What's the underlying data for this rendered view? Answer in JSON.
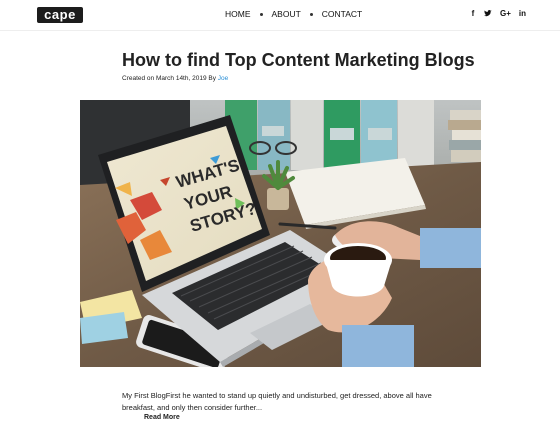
{
  "header": {
    "logo": "cape",
    "nav": [
      {
        "label": "HOME"
      },
      {
        "label": "ABOUT"
      },
      {
        "label": "CONTACT"
      }
    ],
    "social": [
      {
        "icon": "facebook-icon",
        "glyph": "f"
      },
      {
        "icon": "twitter-icon",
        "glyph": "t"
      },
      {
        "icon": "google-plus-icon",
        "glyph": "G+"
      },
      {
        "icon": "linkedin-icon",
        "glyph": "in"
      }
    ]
  },
  "post": {
    "title": "How to find Top Content Marketing Blogs",
    "meta_prefix": "Created on March 14th, 2019 By",
    "author": "Joe",
    "image": {
      "screen_text_line1": "WHAT'S",
      "screen_text_line2": "YOUR",
      "screen_text_line3": "STORY?"
    },
    "excerpt": "My First BlogFirst he wanted to stand up quietly and undisturbed, get dressed, above all have breakfast, and only then consider further...",
    "read_more": "Read More"
  },
  "colors": {
    "author_link": "#2a8fd6",
    "logo_bg": "#1c1c1c"
  }
}
